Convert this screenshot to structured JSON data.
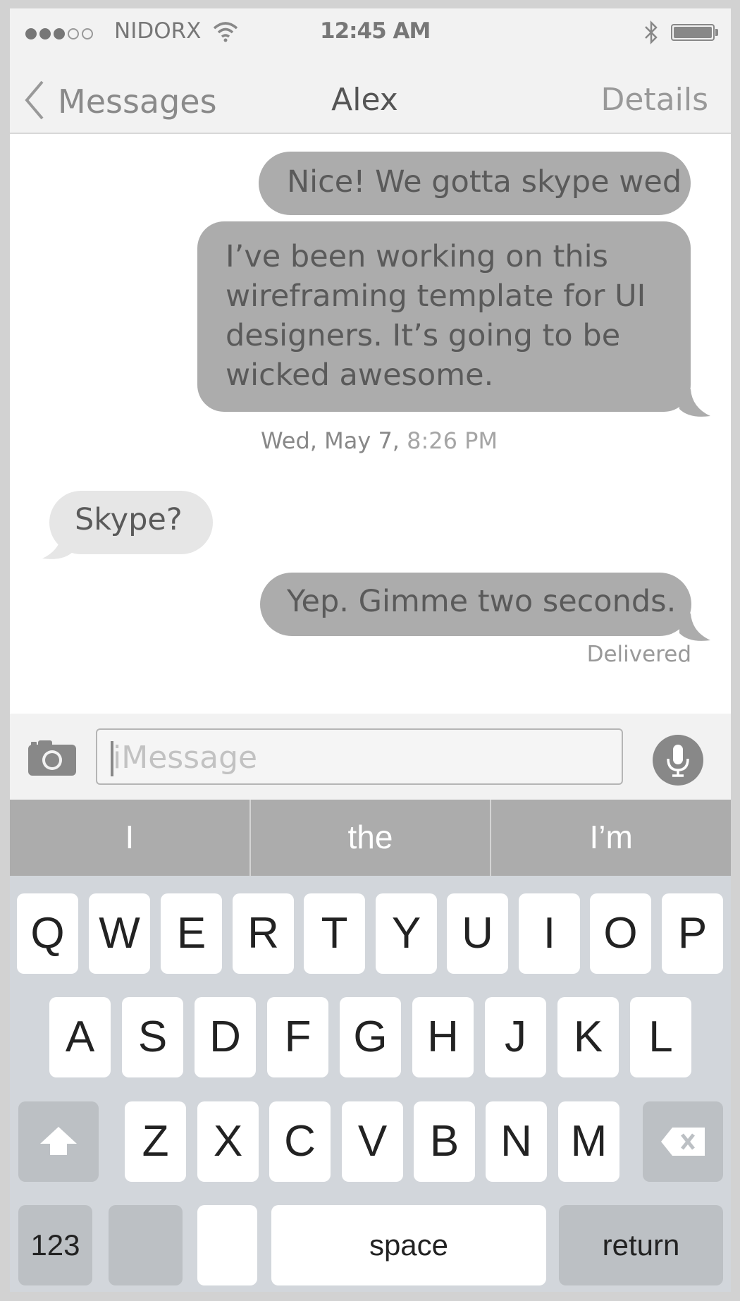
{
  "status_bar": {
    "carrier": "NIDORX",
    "time": "12:45 AM",
    "signal_bars_filled": 3,
    "signal_bars_total": 5,
    "icons": [
      "wifi-icon",
      "bluetooth-icon",
      "battery-icon"
    ]
  },
  "nav": {
    "back_label": "Messages",
    "title": "Alex",
    "details_label": "Details"
  },
  "messages": [
    {
      "direction": "outgoing",
      "text": "Nice! We gotta skype wed"
    },
    {
      "direction": "outgoing",
      "text": "I’ve been working on this wireframing template for UI designers. It’s going to be wicked awesome."
    },
    {
      "direction": "incoming",
      "text": "Skype?"
    },
    {
      "direction": "outgoing",
      "text": "Yep. Gimme two seconds."
    }
  ],
  "timestamp": {
    "date": "Wed, May 7,",
    "time": "8:26 PM"
  },
  "delivered_label": "Delivered",
  "input": {
    "placeholder": "iMessage",
    "value": ""
  },
  "predictions": [
    "I",
    "the",
    "I’m"
  ],
  "keyboard": {
    "row1": [
      "Q",
      "W",
      "E",
      "R",
      "T",
      "Y",
      "U",
      "I",
      "O",
      "P"
    ],
    "row2": [
      "A",
      "S",
      "D",
      "F",
      "G",
      "H",
      "J",
      "K",
      "L"
    ],
    "row3": [
      "Z",
      "X",
      "C",
      "V",
      "B",
      "N",
      "M"
    ],
    "numbers_label": "123",
    "space_label": "space",
    "return_label": "return"
  },
  "colors": {
    "outgoing_bubble": "#acacac",
    "incoming_bubble": "#e6e6e6",
    "keyboard_bg": "#d2d6db",
    "prediction_bar": "#acacac"
  }
}
